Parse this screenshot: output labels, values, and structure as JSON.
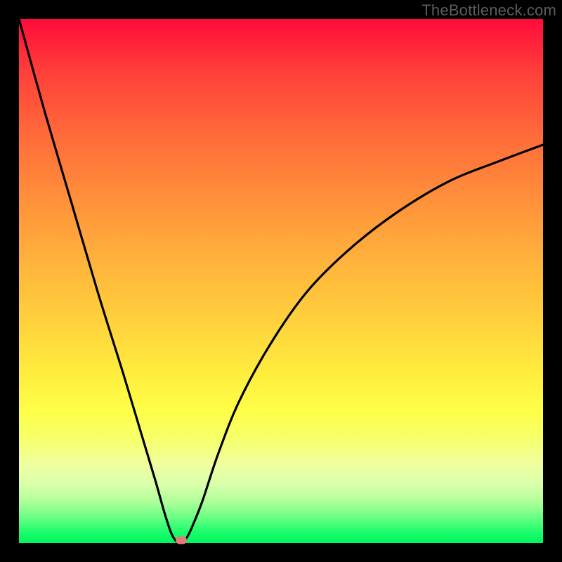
{
  "watermark": "TheBottleneck.com",
  "colors": {
    "frame": "#000000",
    "curve": "#000000",
    "marker": "#e77a77"
  },
  "chart_data": {
    "type": "line",
    "title": "",
    "xlabel": "",
    "ylabel": "",
    "xlim": [
      0,
      100
    ],
    "ylim": [
      0,
      100
    ],
    "background_gradient": {
      "top": "#ff0a3a",
      "bottom": "#00f55e",
      "description": "vertical red→orange→yellow→green"
    },
    "series": [
      {
        "name": "bottleneck-curve",
        "x": [
          0,
          5,
          10,
          15,
          20,
          23,
          26,
          28,
          29.5,
          31,
          32,
          33,
          35,
          38,
          42,
          48,
          55,
          63,
          72,
          82,
          92,
          100
        ],
        "y": [
          100,
          82,
          65,
          48,
          32,
          22,
          12,
          5,
          1,
          0,
          1,
          3,
          8,
          17,
          27,
          38,
          48,
          56,
          63,
          69,
          73,
          76
        ]
      }
    ],
    "annotations": [
      {
        "name": "optimal-marker",
        "x": 31,
        "y": 0.5
      }
    ]
  }
}
